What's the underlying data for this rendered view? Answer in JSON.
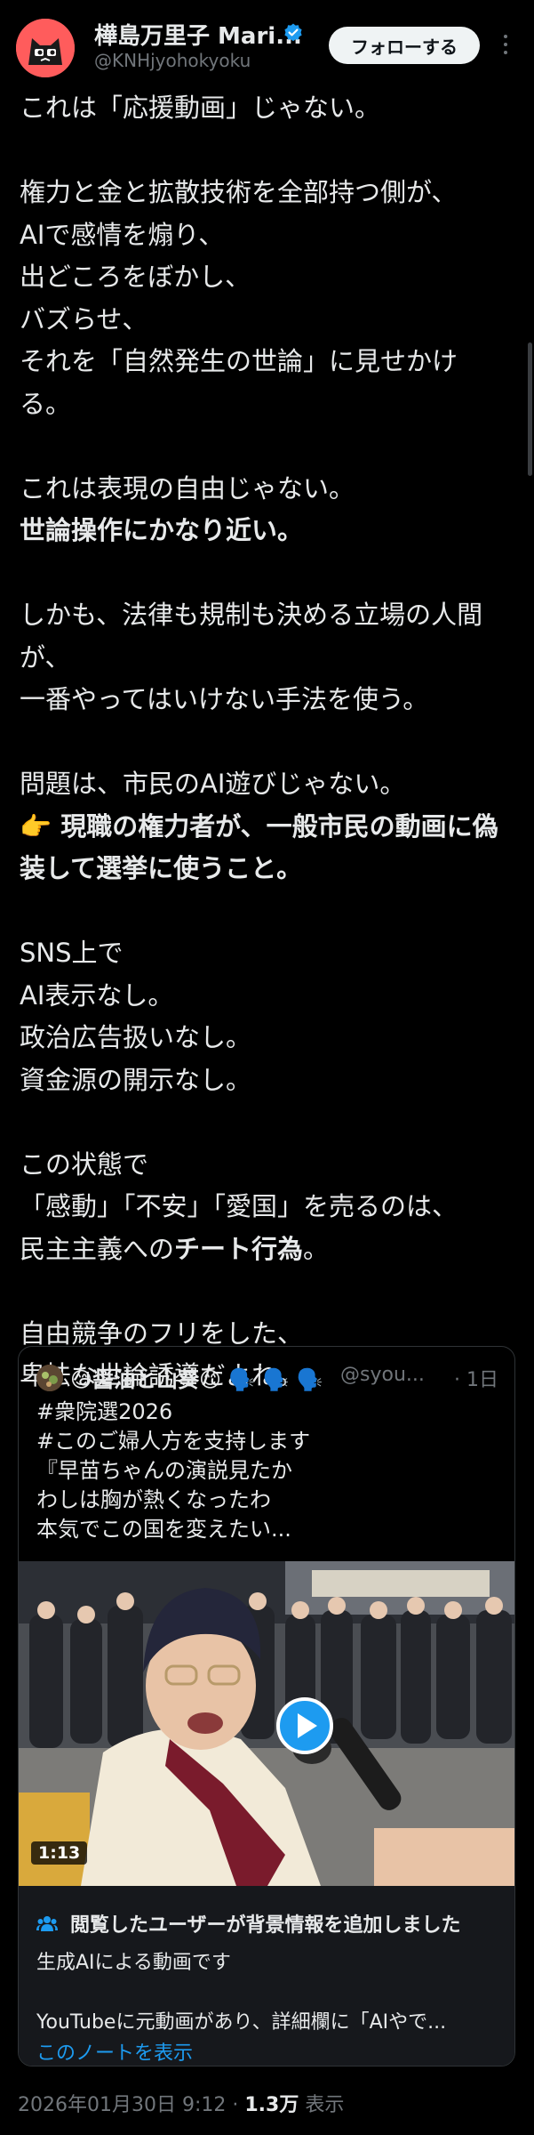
{
  "author": {
    "display_name": "樺島万里子 Mari...",
    "handle": "@KNHjyohokyoku",
    "follow_label": "フォローする",
    "verified_color": "#1d9bf0"
  },
  "post_lines": [
    {
      "text": "これは「応援動画」じゃない。",
      "bold": false
    },
    {
      "text": "",
      "bold": false
    },
    {
      "text": "権力と金と拡散技術を全部持つ側が、",
      "bold": false
    },
    {
      "text": "AIで感情を煽り、",
      "bold": false
    },
    {
      "text": "出どころをぼかし、",
      "bold": false
    },
    {
      "text": "バズらせ、",
      "bold": false
    },
    {
      "text": "それを「自然発生の世論」に見せかけ",
      "bold": false
    },
    {
      "text": "る。",
      "bold": false
    },
    {
      "text": "",
      "bold": false
    },
    {
      "text": "これは表現の自由じゃない。",
      "bold": false
    },
    {
      "text": " 世論操作にかなり近い。",
      "bold": true
    },
    {
      "text": "",
      "bold": false
    },
    {
      "text": "しかも、法律も規制も決める立場の人間",
      "bold": false
    },
    {
      "text": "が、",
      "bold": false
    },
    {
      "text": "一番やってはいけない手法を使う。",
      "bold": false
    },
    {
      "text": "",
      "bold": false
    },
    {
      "text": "問題は、市民のAI遊びじゃない。",
      "bold": false
    },
    {
      "text": "👉 現職の権力者が、一般市民の動画に偽",
      "bold": true
    },
    {
      "text": "装して選挙に使うこと。",
      "bold": true
    },
    {
      "text": "",
      "bold": false
    },
    {
      "text": "SNS上で",
      "bold": false
    },
    {
      "text": "AI表示なし。",
      "bold": false
    },
    {
      "text": "政治広告扱いなし。",
      "bold": false
    },
    {
      "text": "資金源の開示なし。",
      "bold": false
    },
    {
      "text": "",
      "bold": false
    },
    {
      "text": "この状態で",
      "bold": false
    },
    {
      "text": "「感動」「不安」「愛国」を売るのは、",
      "bold": false
    },
    {
      "text": "民主主義へのチート行為。",
      "bold": false
    },
    {
      "text": "",
      "bold": false
    },
    {
      "text": "自由競争のフリをした、",
      "bold": false
    },
    {
      "text": "卑怯な世論誘導だよね。",
      "bold": false
    }
  ],
  "quote": {
    "name": "😊醤油と山葵😊 🗣️ 🗣️ 🗣️",
    "handle": "@syou...",
    "time": "· 1日",
    "lines": [
      "#衆院選2026",
      "#このご婦人方を支持します",
      "『早苗ちゃんの演説見たか",
      "わしは胸が熱くなったわ",
      "本気でこの国を変えたい..."
    ],
    "video": {
      "duration": "1:13",
      "play_color": "#1d9bf0"
    },
    "note": {
      "title": "閲覧したユーザーが背景情報を追加しました",
      "line1": "生成AIによる動画です",
      "line2": "YouTubeに元動画があり、詳細欄に「AIやで...",
      "link": "このノートを表示",
      "link_color": "#1d9bf0"
    }
  },
  "footer": {
    "datetime": "2026年01月30日 9:12 · ",
    "views_count": "1.3万",
    "views_label": " 表示"
  }
}
